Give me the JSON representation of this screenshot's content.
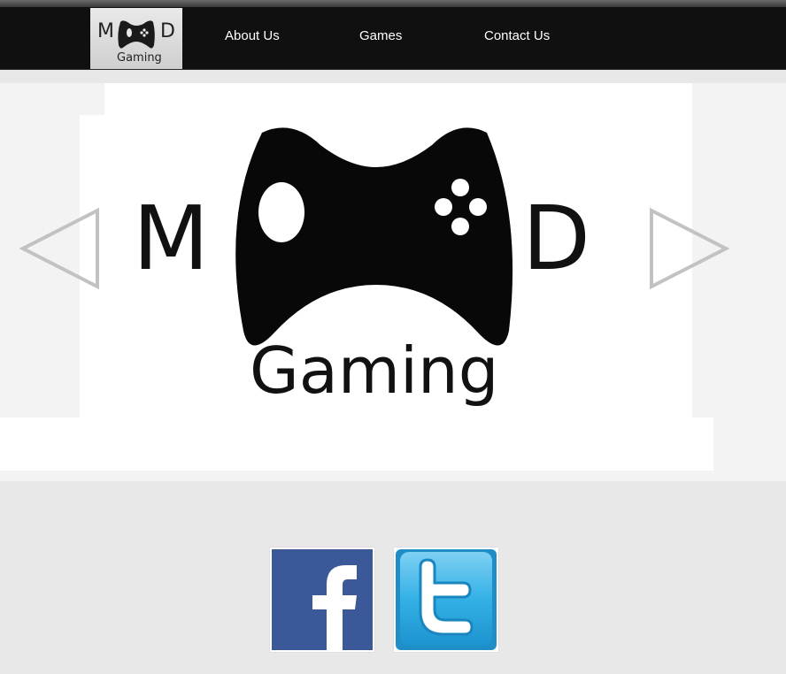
{
  "brand": {
    "logo_letters": {
      "left": "M",
      "right": "D",
      "word": "Gaming"
    }
  },
  "nav": {
    "items": [
      {
        "label": "About Us"
      },
      {
        "label": "Games"
      },
      {
        "label": "Contact Us"
      }
    ]
  },
  "slider": {
    "slide_logo": {
      "left": "M",
      "right": "D",
      "word": "Gaming"
    },
    "prev_icon": "triangle-left-outline",
    "next_icon": "triangle-right-outline"
  },
  "social": [
    {
      "name": "facebook",
      "icon": "facebook-f",
      "color": "#3b5998"
    },
    {
      "name": "twitter",
      "icon": "twitter-t",
      "color": "#2fa8e0"
    }
  ],
  "colors": {
    "navbar": "#101010",
    "page_background": "#e8e8e8",
    "nav_text": "#ffffff"
  }
}
